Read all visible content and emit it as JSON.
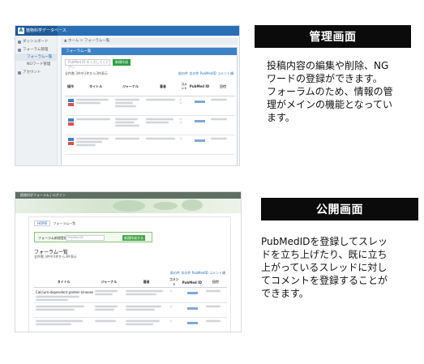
{
  "admin": {
    "label": "管理画面",
    "description_lines": [
      "投稿内容の編集や削除、NG",
      "ワードの登録ができます。",
      "フォーラムのため、情報の管",
      "理がメインの機能となってい",
      "ます。"
    ],
    "app_title": "植物科学データベース",
    "sidebar_items": [
      "ダッシュボード",
      "フォーラム管理",
      "フォーラム一覧",
      "NGワード管理",
      "アカウント"
    ],
    "breadcrumb": "▲ ホーム > フォーラム一覧",
    "panel_title": "フォーラム一覧",
    "search_placeholder": "PubMed ID を入力してください",
    "search_button": "新規作成",
    "result_count": "全件数 3件中1件から3件表示",
    "pager": "前の件 次の件 PubMedID コメント順",
    "table_headers": [
      "操作",
      "タイトル",
      "ジャーナル",
      "著者",
      "コメント",
      "PubMed ID",
      "日付"
    ]
  },
  "public": {
    "label": "公開画面",
    "description_lines": [
      "PubMedIDを登録してスレッ",
      "ドを立ち上げたり、既に立ち",
      "上がっているスレッドに対し",
      "てコメントを登録することが",
      "できます。"
    ],
    "top_text": "植物科学フォーラム  |  ログイン",
    "breadcrumb_home": "HOME",
    "breadcrumb": "フォーラム一覧",
    "search_label": "フォーラム新規登録",
    "search_placeholder": "PubMed ID",
    "search_button": "新規作成する",
    "section_title": "フォーラム一覧",
    "result_count": "全件数 3件中1件から3件表示",
    "pager": "前の件 次の件 PubMedID コメント順",
    "table_headers": [
      "タイトル",
      "ジャーナル",
      "著者",
      "コメント",
      "PubMed ID",
      "日付"
    ],
    "first_row_title": "Calcium-dependent protein kinases"
  }
}
